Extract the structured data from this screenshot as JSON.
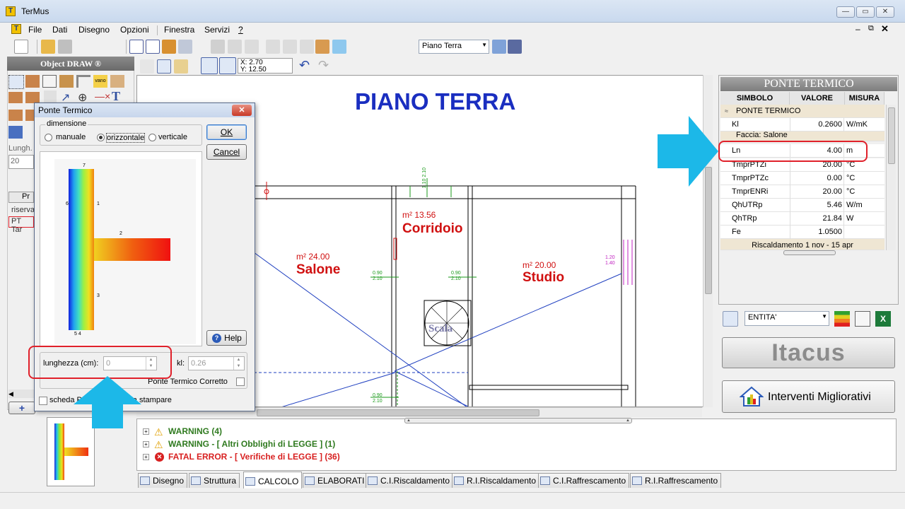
{
  "window": {
    "title": "TerMus"
  },
  "menu": [
    {
      "label": "File",
      "accel": "F"
    },
    {
      "label": "Dati",
      "accel": "t"
    },
    {
      "label": "Disegno",
      "accel": ""
    },
    {
      "label": "Opzioni",
      "accel": "O"
    },
    {
      "label": "Finestra",
      "accel": "F"
    },
    {
      "label": "Servizi",
      "accel": ""
    },
    {
      "label": "?",
      "accel": "?"
    }
  ],
  "toolbar": {
    "floor_select": "Piano Terra",
    "coord_x": "X: 2.70",
    "coord_y": "Y: 12.50"
  },
  "left_panel": {
    "title": "Object DRAW ®",
    "lungh_label": "Lungh.",
    "lungh_value": "20",
    "tab_label": "Pr",
    "list_item1": "riserva",
    "list_item2": "PT Tar",
    "add_button": "+"
  },
  "drawing": {
    "title": "PIANO TERRA",
    "rooms": [
      {
        "area": "m² 24.00",
        "name": "Salone"
      },
      {
        "area": "m² 13.56",
        "name": "Corridoio"
      },
      {
        "area": "m² 20.00",
        "name": "Studio"
      }
    ],
    "stair_label": "Scala",
    "dims": {
      "d1": "0.90",
      "d1b": "2.10",
      "d2": "0.90",
      "d2b": "2.10",
      "d3": "1.10",
      "d3b": "2.10",
      "d4": "0.90",
      "d4b": "2.10",
      "d5": "1.20",
      "d5b": "1.40"
    }
  },
  "dialog": {
    "title": "Ponte Termico",
    "group_label": "dimensione",
    "radio_manuale": "manuale",
    "radio_orizzontale": "orizzontale",
    "radio_verticale": "verticale",
    "ok": "OK",
    "cancel": "Cancel",
    "help": "Help",
    "lunghezza_label": "lunghezza (cm):",
    "lunghezza_value": "0",
    "kl_label": "kl:",
    "kl_value": "0.26",
    "corretto_label": "Ponte Termico Corretto",
    "scheda_label": "scheda Ponte Termico da stampare"
  },
  "right_panel": {
    "title": "PONTE TERMICO",
    "columns": [
      "SIMBOLO",
      "VALORE",
      "MISURA"
    ],
    "group1": "PONTE TERMICO",
    "group2": "Faccia: Salone",
    "rows": [
      {
        "sym": "Kl",
        "val": "0.2600",
        "unit": "W/mK"
      },
      {
        "sym": "Ln",
        "val": "4.00",
        "unit": "m"
      },
      {
        "sym": "TmprPTZi",
        "val": "20.00",
        "unit": "°C"
      },
      {
        "sym": "TmprPTZc",
        "val": "0.00",
        "unit": "°C"
      },
      {
        "sym": "TmprENRi",
        "val": "20.00",
        "unit": "°C"
      },
      {
        "sym": "QhUTRp",
        "val": "5.46",
        "unit": "W/m"
      },
      {
        "sym": "QhTRp",
        "val": "21.84",
        "unit": "W"
      },
      {
        "sym": "Fe",
        "val": "1.0500",
        "unit": ""
      }
    ],
    "footer_row": "Riscaldamento 1 nov - 15 apr",
    "entity_select": "ENTITA'",
    "itacus": "Itacus",
    "interventi": "Interventi Migliorativi"
  },
  "messages": [
    {
      "text": "WARNING  (4)",
      "type": "warning"
    },
    {
      "text": "WARNING  -  [ Altri Obblighi di LEGGE ]  (1)",
      "type": "warning"
    },
    {
      "text": "FATAL ERROR  -  [ Verifiche di LEGGE ]  (36)",
      "type": "error"
    }
  ],
  "tabs": [
    {
      "label": "Disegno"
    },
    {
      "label": "Struttura"
    },
    {
      "label": "CALCOLO"
    },
    {
      "label": "ELABORATI"
    },
    {
      "label": "C.I.Riscaldamento"
    },
    {
      "label": "R.I.Riscaldamento"
    },
    {
      "label": "C.I.Raffrescamento"
    },
    {
      "label": "R.I.Raffrescamento"
    }
  ],
  "colors": {
    "accent_red": "#e0202a",
    "arrow": "#1cb8e8",
    "title_blue": "#1a2ec0",
    "room_red": "#d01010"
  }
}
